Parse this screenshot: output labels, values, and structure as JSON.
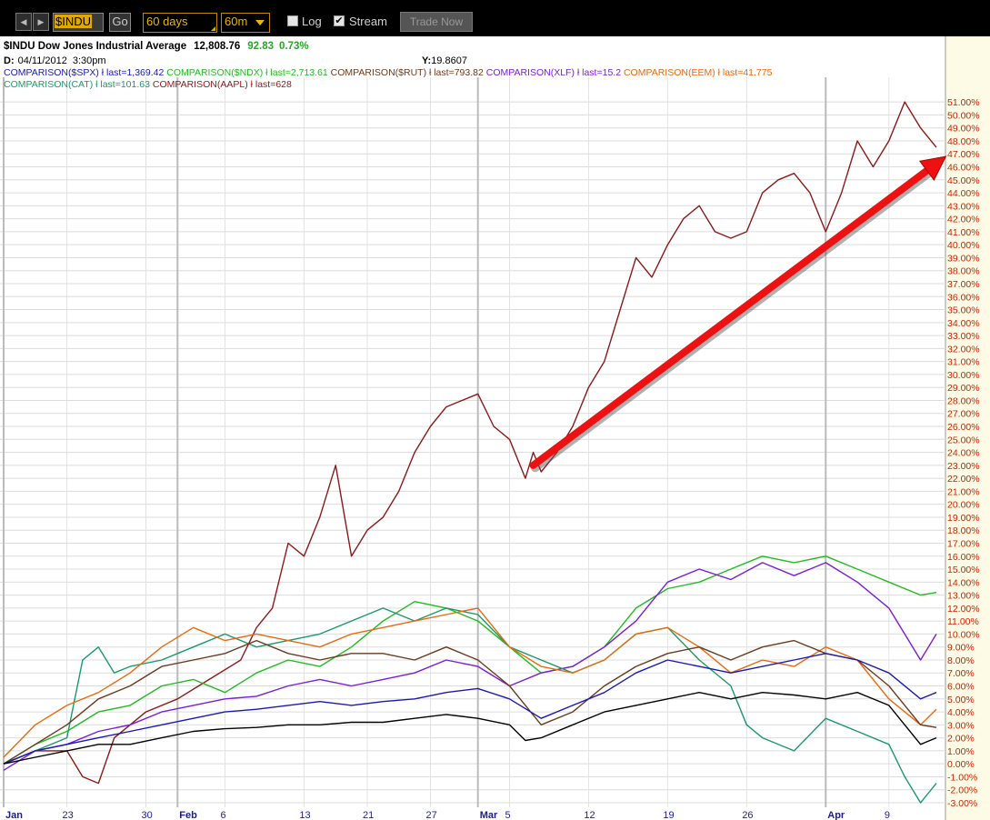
{
  "toolbar": {
    "symbol": "$INDU",
    "go_label": "Go",
    "period": "60 days",
    "interval": "60m",
    "log_label": "Log",
    "log_checked": false,
    "stream_label": "Stream",
    "stream_checked": true,
    "trade_label": "Trade Now"
  },
  "header": {
    "title": "$INDU Dow Jones Industrial Average",
    "last": "12,808.76",
    "change": "92.83",
    "change_pct": "0.73%",
    "cursor_date_label": "D:",
    "cursor_date": "04/11/2012",
    "cursor_time": "3:30pm",
    "cursor_y_label": "Y:",
    "cursor_y": "19.8607"
  },
  "legend": [
    {
      "name": "COMPARISON($SPX)",
      "last": "last=1,369.42",
      "color": "#1a1ab0"
    },
    {
      "name": "COMPARISON($NDX)",
      "last": "last=2,713.61",
      "color": "#22bb22"
    },
    {
      "name": "COMPARISON($RUT)",
      "last": "last=793.82",
      "color": "#6b3a1e"
    },
    {
      "name": "COMPARISON(XLF)",
      "last": "last=15.2",
      "color": "#7a1ed8"
    },
    {
      "name": "COMPARISON(EEM)",
      "last": "last=41.775",
      "color": "#e86a10"
    },
    {
      "name": "COMPARISON(CAT)",
      "last": "last=101.63",
      "color": "#1a9a6a"
    },
    {
      "name": "COMPARISON(AAPL)",
      "last": "last=628",
      "color": "#8b1a1a"
    }
  ],
  "colors": {
    "indu": "#000000",
    "axis_text": "#cc2200",
    "date_text": "#1a1aa0",
    "plot_bg": "#ffffff",
    "axis_bg": "#fdfbe6",
    "change_positive": "#22aa22",
    "arrow": "#ee1111"
  },
  "chart_data": {
    "type": "line",
    "title": "$INDU Dow Jones Industrial Average",
    "ylim": [
      -3,
      51.5
    ],
    "y_tick_format": "percent",
    "y_ticks": [
      51,
      50,
      49,
      48,
      47,
      46,
      45,
      44,
      43,
      42,
      41,
      40,
      39,
      38,
      37,
      36,
      35,
      34,
      33,
      32,
      31,
      30,
      29,
      28,
      27,
      26,
      25,
      24,
      23,
      22,
      21,
      20,
      19,
      18,
      17,
      16,
      15,
      14,
      13,
      12,
      11,
      10,
      9,
      8,
      7,
      6,
      5,
      4,
      3,
      2,
      1,
      0,
      -1,
      -2,
      -3
    ],
    "x_labels": [
      {
        "label": "Jan",
        "day": 0,
        "month": true
      },
      {
        "label": "23",
        "day": 4,
        "month": false
      },
      {
        "label": "30",
        "day": 9,
        "month": false
      },
      {
        "label": "Feb",
        "day": 11,
        "month": true
      },
      {
        "label": "6",
        "day": 14,
        "month": false
      },
      {
        "label": "13",
        "day": 19,
        "month": false
      },
      {
        "label": "21",
        "day": 23,
        "month": false
      },
      {
        "label": "27",
        "day": 27,
        "month": false
      },
      {
        "label": "Mar",
        "day": 30,
        "month": true
      },
      {
        "label": "5",
        "day": 32,
        "month": false
      },
      {
        "label": "12",
        "day": 37,
        "month": false
      },
      {
        "label": "19",
        "day": 42,
        "month": false
      },
      {
        "label": "26",
        "day": 47,
        "month": false
      },
      {
        "label": "Apr",
        "day": 52,
        "month": true
      },
      {
        "label": "9",
        "day": 56,
        "month": false
      }
    ],
    "x_max": 59,
    "grid": true,
    "series": [
      {
        "name": "COMPARISON(AAPL)",
        "color": "#8b1a1a",
        "points": [
          [
            0,
            0
          ],
          [
            2,
            1
          ],
          [
            4,
            1
          ],
          [
            5,
            -1
          ],
          [
            6,
            -1.5
          ],
          [
            7,
            2
          ],
          [
            9,
            4
          ],
          [
            11,
            5
          ],
          [
            13,
            6.5
          ],
          [
            15,
            8
          ],
          [
            16,
            10.5
          ],
          [
            17,
            12
          ],
          [
            18,
            17
          ],
          [
            19,
            16
          ],
          [
            20,
            19
          ],
          [
            21,
            23
          ],
          [
            22,
            16
          ],
          [
            23,
            18
          ],
          [
            24,
            19
          ],
          [
            25,
            21
          ],
          [
            26,
            24
          ],
          [
            27,
            26
          ],
          [
            28,
            27.5
          ],
          [
            30,
            28.5
          ],
          [
            31,
            26
          ],
          [
            32,
            25
          ],
          [
            33,
            22
          ],
          [
            33.5,
            24
          ],
          [
            34,
            22.5
          ],
          [
            35,
            24
          ],
          [
            36,
            26
          ],
          [
            37,
            29
          ],
          [
            38,
            31
          ],
          [
            39,
            35
          ],
          [
            40,
            39
          ],
          [
            41,
            37.5
          ],
          [
            42,
            40
          ],
          [
            43,
            42
          ],
          [
            44,
            43
          ],
          [
            45,
            41
          ],
          [
            46,
            40.5
          ],
          [
            47,
            41
          ],
          [
            48,
            44
          ],
          [
            49,
            45
          ],
          [
            50,
            45.5
          ],
          [
            51,
            44
          ],
          [
            52,
            41
          ],
          [
            53,
            44
          ],
          [
            54,
            48
          ],
          [
            55,
            46
          ],
          [
            56,
            48
          ],
          [
            57,
            51
          ],
          [
            58,
            49
          ],
          [
            59,
            47.5
          ]
        ]
      },
      {
        "name": "COMPARISON($NDX)",
        "color": "#22bb22",
        "points": [
          [
            0,
            0
          ],
          [
            2,
            1.5
          ],
          [
            4,
            2.5
          ],
          [
            6,
            4
          ],
          [
            8,
            4.5
          ],
          [
            10,
            6
          ],
          [
            12,
            6.5
          ],
          [
            14,
            5.5
          ],
          [
            16,
            7
          ],
          [
            18,
            8
          ],
          [
            20,
            7.5
          ],
          [
            22,
            9
          ],
          [
            24,
            11
          ],
          [
            26,
            12.5
          ],
          [
            28,
            12
          ],
          [
            30,
            11
          ],
          [
            32,
            9
          ],
          [
            34,
            7
          ],
          [
            36,
            7.5
          ],
          [
            38,
            9
          ],
          [
            40,
            12
          ],
          [
            42,
            13.5
          ],
          [
            44,
            14
          ],
          [
            46,
            15
          ],
          [
            48,
            16
          ],
          [
            50,
            15.5
          ],
          [
            52,
            16
          ],
          [
            54,
            15
          ],
          [
            56,
            14
          ],
          [
            58,
            13
          ],
          [
            59,
            13.2
          ]
        ]
      },
      {
        "name": "COMPARISON(XLF)",
        "color": "#7a1ed8",
        "points": [
          [
            0,
            -0.5
          ],
          [
            2,
            1
          ],
          [
            4,
            1.5
          ],
          [
            6,
            2.5
          ],
          [
            8,
            3
          ],
          [
            10,
            4
          ],
          [
            12,
            4.5
          ],
          [
            14,
            5
          ],
          [
            16,
            5.2
          ],
          [
            18,
            6
          ],
          [
            20,
            6.5
          ],
          [
            22,
            6
          ],
          [
            24,
            6.5
          ],
          [
            26,
            7
          ],
          [
            28,
            8
          ],
          [
            30,
            7.5
          ],
          [
            32,
            6
          ],
          [
            34,
            7
          ],
          [
            36,
            7.5
          ],
          [
            38,
            9
          ],
          [
            40,
            11
          ],
          [
            42,
            14
          ],
          [
            44,
            15
          ],
          [
            46,
            14.2
          ],
          [
            48,
            15.5
          ],
          [
            50,
            14.5
          ],
          [
            52,
            15.5
          ],
          [
            54,
            14
          ],
          [
            56,
            12
          ],
          [
            58,
            8
          ],
          [
            59,
            10
          ]
        ]
      },
      {
        "name": "COMPARISON(CAT)",
        "color": "#1a9a6a",
        "points": [
          [
            0,
            0
          ],
          [
            2,
            1
          ],
          [
            4,
            2
          ],
          [
            5,
            8
          ],
          [
            6,
            9
          ],
          [
            7,
            7
          ],
          [
            8,
            7.5
          ],
          [
            10,
            8
          ],
          [
            12,
            9
          ],
          [
            14,
            10
          ],
          [
            16,
            9
          ],
          [
            18,
            9.5
          ],
          [
            20,
            10
          ],
          [
            22,
            11
          ],
          [
            24,
            12
          ],
          [
            26,
            11
          ],
          [
            28,
            12
          ],
          [
            30,
            11.5
          ],
          [
            32,
            9
          ],
          [
            34,
            8
          ],
          [
            36,
            7
          ],
          [
            38,
            8
          ],
          [
            40,
            10
          ],
          [
            42,
            10.5
          ],
          [
            44,
            8
          ],
          [
            46,
            6
          ],
          [
            47,
            3
          ],
          [
            48,
            2
          ],
          [
            50,
            1
          ],
          [
            52,
            3.5
          ],
          [
            54,
            2.5
          ],
          [
            56,
            1.5
          ],
          [
            57,
            -1
          ],
          [
            58,
            -3
          ],
          [
            59,
            -1.5
          ]
        ]
      },
      {
        "name": "COMPARISON(EEM)",
        "color": "#e86a10",
        "points": [
          [
            0,
            0.5
          ],
          [
            2,
            3
          ],
          [
            4,
            4.5
          ],
          [
            6,
            5.5
          ],
          [
            8,
            7
          ],
          [
            10,
            9
          ],
          [
            12,
            10.5
          ],
          [
            14,
            9.5
          ],
          [
            16,
            10
          ],
          [
            18,
            9.5
          ],
          [
            20,
            9
          ],
          [
            22,
            10
          ],
          [
            24,
            10.5
          ],
          [
            26,
            11
          ],
          [
            28,
            11.5
          ],
          [
            30,
            12
          ],
          [
            32,
            9
          ],
          [
            34,
            7.5
          ],
          [
            36,
            7
          ],
          [
            38,
            8
          ],
          [
            40,
            10
          ],
          [
            42,
            10.5
          ],
          [
            44,
            9
          ],
          [
            46,
            7
          ],
          [
            48,
            8
          ],
          [
            50,
            7.5
          ],
          [
            52,
            9
          ],
          [
            54,
            8
          ],
          [
            56,
            5
          ],
          [
            58,
            3
          ],
          [
            59,
            4.2
          ]
        ]
      },
      {
        "name": "COMPARISON($RUT)",
        "color": "#6b3a1e",
        "points": [
          [
            0,
            0
          ],
          [
            2,
            1.5
          ],
          [
            4,
            3
          ],
          [
            6,
            5
          ],
          [
            8,
            6
          ],
          [
            10,
            7.5
          ],
          [
            12,
            8
          ],
          [
            14,
            8.5
          ],
          [
            16,
            9.5
          ],
          [
            18,
            8.5
          ],
          [
            20,
            8
          ],
          [
            22,
            8.5
          ],
          [
            24,
            8.5
          ],
          [
            26,
            8
          ],
          [
            28,
            9
          ],
          [
            30,
            8
          ],
          [
            32,
            6
          ],
          [
            34,
            3
          ],
          [
            36,
            4
          ],
          [
            38,
            6
          ],
          [
            40,
            7.5
          ],
          [
            42,
            8.5
          ],
          [
            44,
            9
          ],
          [
            46,
            8
          ],
          [
            48,
            9
          ],
          [
            50,
            9.5
          ],
          [
            52,
            8.5
          ],
          [
            54,
            8
          ],
          [
            56,
            6
          ],
          [
            58,
            3
          ],
          [
            59,
            2.8
          ]
        ]
      },
      {
        "name": "COMPARISON($SPX)",
        "color": "#1a1ab0",
        "points": [
          [
            0,
            0
          ],
          [
            2,
            1
          ],
          [
            4,
            1.5
          ],
          [
            6,
            2
          ],
          [
            8,
            2.5
          ],
          [
            10,
            3
          ],
          [
            12,
            3.5
          ],
          [
            14,
            4
          ],
          [
            16,
            4.2
          ],
          [
            18,
            4.5
          ],
          [
            20,
            4.8
          ],
          [
            22,
            4.5
          ],
          [
            24,
            4.8
          ],
          [
            26,
            5
          ],
          [
            28,
            5.5
          ],
          [
            30,
            5.8
          ],
          [
            32,
            5
          ],
          [
            34,
            3.5
          ],
          [
            36,
            4.5
          ],
          [
            38,
            5.5
          ],
          [
            40,
            7
          ],
          [
            42,
            8
          ],
          [
            44,
            7.5
          ],
          [
            46,
            7
          ],
          [
            48,
            7.5
          ],
          [
            50,
            8
          ],
          [
            52,
            8.5
          ],
          [
            54,
            8
          ],
          [
            56,
            7
          ],
          [
            58,
            5
          ],
          [
            59,
            5.5
          ]
        ]
      },
      {
        "name": "$INDU",
        "color": "#000000",
        "points": [
          [
            0,
            0
          ],
          [
            2,
            0.5
          ],
          [
            4,
            1
          ],
          [
            6,
            1.5
          ],
          [
            8,
            1.5
          ],
          [
            10,
            2
          ],
          [
            12,
            2.5
          ],
          [
            14,
            2.7
          ],
          [
            16,
            2.8
          ],
          [
            18,
            3
          ],
          [
            20,
            3
          ],
          [
            22,
            3.2
          ],
          [
            24,
            3.2
          ],
          [
            26,
            3.5
          ],
          [
            28,
            3.8
          ],
          [
            30,
            3.5
          ],
          [
            32,
            3
          ],
          [
            33,
            1.8
          ],
          [
            34,
            2
          ],
          [
            36,
            3
          ],
          [
            38,
            4
          ],
          [
            40,
            4.5
          ],
          [
            42,
            5
          ],
          [
            44,
            5.5
          ],
          [
            46,
            5
          ],
          [
            48,
            5.5
          ],
          [
            50,
            5.3
          ],
          [
            52,
            5
          ],
          [
            54,
            5.5
          ],
          [
            56,
            4.5
          ],
          [
            58,
            1.5
          ],
          [
            59,
            2
          ]
        ]
      }
    ],
    "arrow": {
      "from": [
        33.5,
        23
      ],
      "to": [
        59.6,
        46.8
      ]
    }
  }
}
